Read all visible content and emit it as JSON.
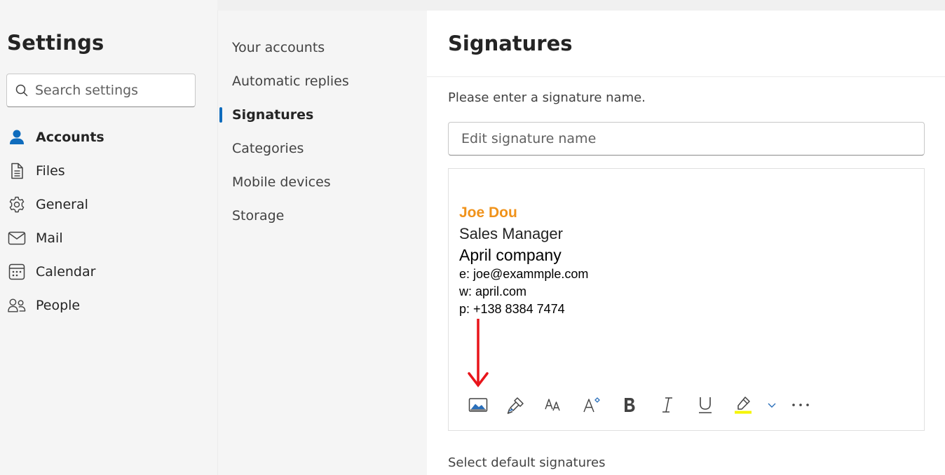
{
  "settings": {
    "title": "Settings",
    "search_placeholder": "Search settings"
  },
  "nav": {
    "items": [
      {
        "label": "Accounts",
        "icon": "person-icon",
        "active": true
      },
      {
        "label": "Files",
        "icon": "file-icon",
        "active": false
      },
      {
        "label": "General",
        "icon": "gear-icon",
        "active": false
      },
      {
        "label": "Mail",
        "icon": "mail-icon",
        "active": false
      },
      {
        "label": "Calendar",
        "icon": "calendar-icon",
        "active": false
      },
      {
        "label": "People",
        "icon": "people-icon",
        "active": false
      }
    ]
  },
  "subnav": {
    "items": [
      {
        "label": "Your accounts",
        "active": false
      },
      {
        "label": "Automatic replies",
        "active": false
      },
      {
        "label": "Signatures",
        "active": true
      },
      {
        "label": "Categories",
        "active": false
      },
      {
        "label": "Mobile devices",
        "active": false
      },
      {
        "label": "Storage",
        "active": false
      }
    ]
  },
  "pane": {
    "title": "Signatures",
    "prompt": "Please enter a signature name.",
    "name_placeholder": "Edit signature name",
    "default_label": "Select default signatures"
  },
  "signature": {
    "name": "Joe Dou",
    "title": "Sales Manager",
    "company": "April company",
    "email": "e: joe@exammple.com",
    "web": "w: april.com",
    "phone": "p: +138 8384 7474"
  },
  "toolbar": {
    "buttons": [
      "insert-image-icon",
      "format-painter-icon",
      "font-size-icon",
      "font-size-increase-icon",
      "bold-icon",
      "italic-icon",
      "underline-icon",
      "highlight-icon",
      "chevron-down-icon",
      "more-icon"
    ]
  },
  "colors": {
    "accent": "#0f6cbd",
    "signature_name": "#f0921a",
    "arrow": "#e8141a",
    "highlight": "#f5f500"
  }
}
